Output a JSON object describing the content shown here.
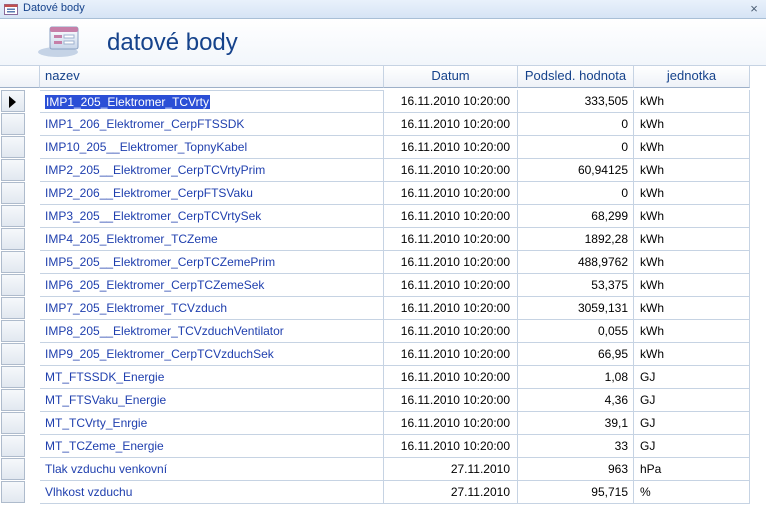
{
  "window": {
    "title": "Datové body",
    "close_glyph": "×"
  },
  "form": {
    "title": "datové body",
    "icon": "form-icon"
  },
  "columns": {
    "name": "nazev",
    "date": "Datum",
    "value": "Podsled. hodnota",
    "unit": "jednotka"
  },
  "rows": [
    {
      "name": "IMP1_205_Elektromer_TCVrty",
      "date": "16.11.2010 10:20:00",
      "value": "333,505",
      "unit": "kWh"
    },
    {
      "name": "IMP1_206_Elektromer_CerpFTSSDK",
      "date": "16.11.2010 10:20:00",
      "value": "0",
      "unit": "kWh"
    },
    {
      "name": "IMP10_205__Elektromer_TopnyKabel",
      "date": "16.11.2010 10:20:00",
      "value": "0",
      "unit": "kWh"
    },
    {
      "name": "IMP2_205__Elektromer_CerpTCVrtyPrim",
      "date": "16.11.2010 10:20:00",
      "value": "60,94125",
      "unit": "kWh"
    },
    {
      "name": "IMP2_206__Elektromer_CerpFTSVaku",
      "date": "16.11.2010 10:20:00",
      "value": "0",
      "unit": "kWh"
    },
    {
      "name": "IMP3_205__Elektromer_CerpTCVrtySek",
      "date": "16.11.2010 10:20:00",
      "value": "68,299",
      "unit": "kWh"
    },
    {
      "name": "IMP4_205_Elektromer_TCZeme",
      "date": "16.11.2010 10:20:00",
      "value": "1892,28",
      "unit": "kWh"
    },
    {
      "name": "IMP5_205__Elektromer_CerpTCZemePrim",
      "date": "16.11.2010 10:20:00",
      "value": "488,9762",
      "unit": "kWh"
    },
    {
      "name": "IMP6_205_Elektromer_CerpTCZemeSek",
      "date": "16.11.2010 10:20:00",
      "value": "53,375",
      "unit": "kWh"
    },
    {
      "name": "IMP7_205_Elektromer_TCVzduch",
      "date": "16.11.2010 10:20:00",
      "value": "3059,131",
      "unit": "kWh"
    },
    {
      "name": "IMP8_205__Elektromer_TCVzduchVentilator",
      "date": "16.11.2010 10:20:00",
      "value": "0,055",
      "unit": "kWh"
    },
    {
      "name": "IMP9_205_Elektromer_CerpTCVzduchSek",
      "date": "16.11.2010 10:20:00",
      "value": "66,95",
      "unit": "kWh"
    },
    {
      "name": "MT_FTSSDK_Energie",
      "date": "16.11.2010 10:20:00",
      "value": "1,08",
      "unit": "GJ"
    },
    {
      "name": "MT_FTSVaku_Energie",
      "date": "16.11.2010 10:20:00",
      "value": "4,36",
      "unit": "GJ"
    },
    {
      "name": "MT_TCVrty_Enrgie",
      "date": "16.11.2010 10:20:00",
      "value": "39,1",
      "unit": "GJ"
    },
    {
      "name": "MT_TCZeme_Energie",
      "date": "16.11.2010 10:20:00",
      "value": "33",
      "unit": "GJ"
    },
    {
      "name": "Tlak vzduchu venkovní",
      "date": "27.11.2010",
      "value": "963",
      "unit": "hPa"
    },
    {
      "name": "Vlhkost vzduchu",
      "date": "27.11.2010",
      "value": "95,715",
      "unit": "%"
    }
  ],
  "selected_row": 0,
  "colors": {
    "link_text": "#1f3fae",
    "highlight": "#2b4fd6",
    "title_text": "#15428b"
  }
}
